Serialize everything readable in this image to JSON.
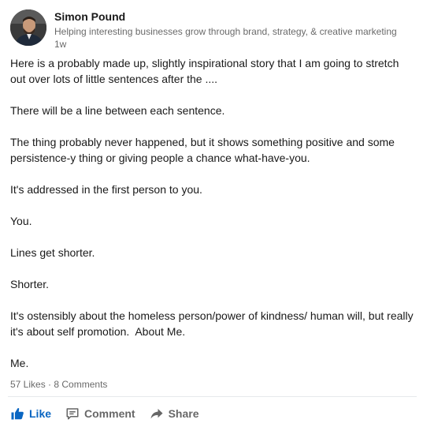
{
  "author": {
    "name": "Simon Pound",
    "headline": "Helping interesting businesses grow through brand, strategy, & creative marketing",
    "time": "1w"
  },
  "post": {
    "paragraphs": [
      "Here is a probably made up, slightly inspirational story that I am going to stretch out over lots of little sentences after the ....",
      "There will be a line between each sentence.",
      "The thing probably never happened, but it shows something positive and some persistence-y thing or giving people a chance what-have-you.",
      "It's addressed in the first person to you.",
      "You.",
      "Lines get shorter.",
      "Shorter.",
      "It's ostensibly about the homeless person/power of kindness/ human will, but really it's about self promotion.  About Me.",
      "Me."
    ]
  },
  "social": {
    "likes": "57 Likes",
    "separator": " · ",
    "comments": "8 Comments"
  },
  "actions": {
    "like": "Like",
    "comment": "Comment",
    "share": "Share"
  },
  "colors": {
    "like_active": "#0a66c2",
    "muted_text": "#666666",
    "divider": "#e6e9ec"
  },
  "icons": {
    "like": "thumbs-up-icon",
    "comment": "comment-icon",
    "share": "share-arrow-icon"
  }
}
